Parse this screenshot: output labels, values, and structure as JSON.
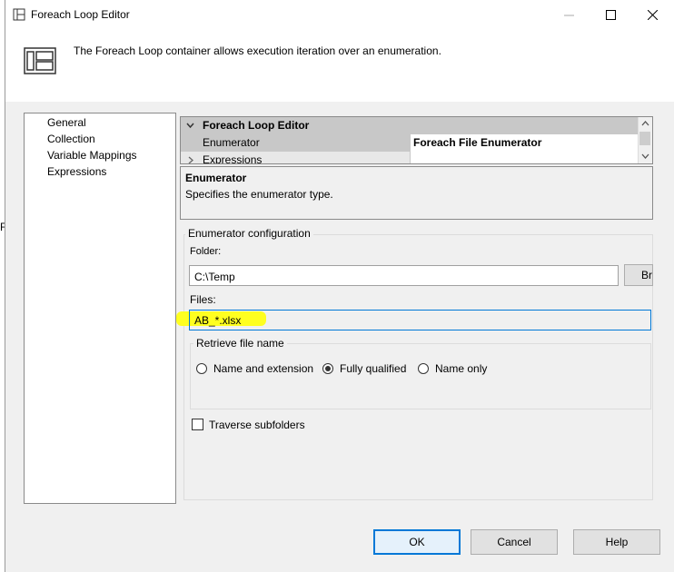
{
  "window": {
    "title": "Foreach Loop Editor"
  },
  "header": {
    "description": "The Foreach Loop container allows execution iteration over an enumeration."
  },
  "nav": {
    "items": [
      {
        "label": "General"
      },
      {
        "label": "Collection"
      },
      {
        "label": "Variable Mappings"
      },
      {
        "label": "Expressions"
      }
    ]
  },
  "grid": {
    "category": "Foreach Loop Editor",
    "rows": [
      {
        "name": "Enumerator",
        "value": "Foreach File Enumerator"
      },
      {
        "name": "Expressions",
        "value": ""
      }
    ]
  },
  "description_panel": {
    "title": "Enumerator",
    "text": "Specifies the enumerator type."
  },
  "config": {
    "group_label": "Enumerator configuration",
    "folder_label": "Folder:",
    "folder_value": "C:\\Temp",
    "browse_label": "Br",
    "files_label": "Files:",
    "files_value": "AB_*.xlsx",
    "retrieve_group_label": "Retrieve file name",
    "options": [
      {
        "label": "Name and extension",
        "selected": false
      },
      {
        "label": "Fully qualified",
        "selected": true
      },
      {
        "label": "Name only",
        "selected": false
      }
    ],
    "traverse_label": "Traverse subfolders",
    "traverse_checked": false
  },
  "buttons": {
    "ok": "OK",
    "cancel": "Cancel",
    "help": "Help"
  },
  "edge_text": "F",
  "colors": {
    "highlight": "#ffff20",
    "default_button_border": "#0078d7"
  }
}
